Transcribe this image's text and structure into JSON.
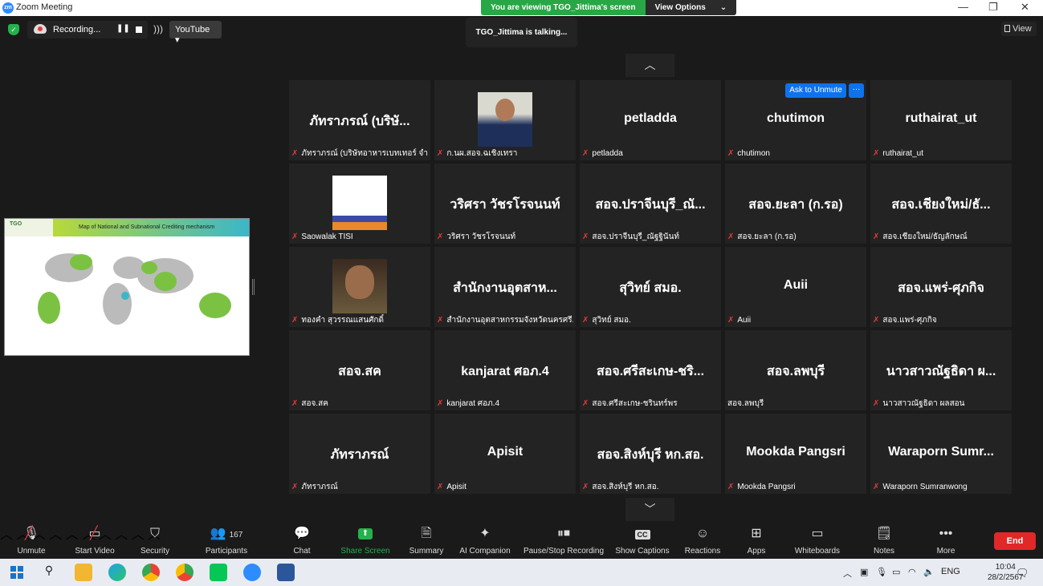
{
  "window": {
    "title": "Zoom Meeting",
    "minimize": "—",
    "restore": "❐",
    "close": "✕"
  },
  "view_banner": {
    "message": "You are viewing TGO_Jittima's screen",
    "options": "View Options"
  },
  "recording": {
    "label": "Recording...",
    "pause": "❚❚"
  },
  "livestream": {
    "label": "YouTube ▾"
  },
  "talking": "TGO_Jittima is talking...",
  "view_button": "View",
  "shared_screen": {
    "title": "Map of National and Subnational Crediting mechanism",
    "logo": "TGO"
  },
  "nav": {
    "up": "︿",
    "down": "﹀"
  },
  "ask_to_unmute": "Ask to Unmute",
  "more_dots": "···",
  "tiles": [
    {
      "name": "ภัทราภรณ์ (บริษั...",
      "label": "ภัทราภรณ์ (บริษัทอาหารเบทเทอร์ จำ...",
      "muted": true
    },
    {
      "name": "",
      "label": "ก.นผ.สอจ.ฉเชิงเทรา",
      "muted": true,
      "thumb": "t1"
    },
    {
      "name": "petladda",
      "label": "petladda",
      "muted": true
    },
    {
      "name": "chutimon",
      "label": "chutimon",
      "muted": true
    },
    {
      "name": "ruthairat_ut",
      "label": "ruthairat_ut",
      "muted": true
    },
    {
      "name": "",
      "label": "Saowalak TISI",
      "muted": true,
      "thumb": "t2"
    },
    {
      "name": "วริศรา วัชรโรจนนท์",
      "label": "วริศรา วัชรโรจนนท์",
      "muted": true
    },
    {
      "name": "สอจ.ปราจีนบุรี_ณั...",
      "label": "สอจ.ปราจีนบุรี_ณัฐฐินันท์",
      "muted": true
    },
    {
      "name": "สอจ.ยะลา (ก.รอ)",
      "label": "สอจ.ยะลา (ก.รอ)",
      "muted": true
    },
    {
      "name": "สอจ.เชียงใหม่/ธั...",
      "label": "สอจ.เชียงใหม่/ธัญลักษณ์",
      "muted": true
    },
    {
      "name": "",
      "label": "ทองคำ สุวรรณแสนศักดิ์",
      "muted": true,
      "thumb": "t3"
    },
    {
      "name": "สำนักงานอุตสาห...",
      "label": "สำนักงานอุตสาหกรรมจังหวัดนครศรี...",
      "muted": true
    },
    {
      "name": "สุวิทย์ สมอ.",
      "label": "สุวิทย์ สมอ.",
      "muted": true
    },
    {
      "name": "Auii",
      "label": "Auii",
      "muted": true
    },
    {
      "name": "สอจ.แพร่-ศุภกิจ",
      "label": "สอจ.แพร่-ศุภกิจ",
      "muted": true
    },
    {
      "name": "สอจ.สค",
      "label": "สอจ.สค",
      "muted": true
    },
    {
      "name": "kanjarat ศอภ.4",
      "label": "kanjarat ศอภ.4",
      "muted": true
    },
    {
      "name": "สอจ.ศรีสะเกษ-ชริ...",
      "label": "สอจ.ศรีสะเกษ-ชรินทร์พร",
      "muted": true
    },
    {
      "name": "สอจ.ลพบุรี",
      "label": "สอจ.ลพบุรี",
      "muted": false
    },
    {
      "name": "นาวสาวณัฐธิดา ผ...",
      "label": "นาวสาวณัฐธิดา ผลสอน",
      "muted": true
    },
    {
      "name": "ภัทราภรณ์",
      "label": "ภัทราภรณ์",
      "muted": true
    },
    {
      "name": "Apisit",
      "label": "Apisit",
      "muted": true
    },
    {
      "name": "สอจ.สิงห์บุรี หก.สอ.",
      "label": "สอจ.สิงห์บุรี หก.สอ.",
      "muted": true
    },
    {
      "name": "Mookda Pangsri",
      "label": "Mookda Pangsri",
      "muted": true
    },
    {
      "name": "Waraporn Sumr...",
      "label": "Waraporn Sumranwong",
      "muted": true
    }
  ],
  "toolbar": {
    "unmute": "Unmute",
    "start_video": "Start Video",
    "security": "Security",
    "participants": "Participants",
    "participants_count": "167",
    "chat": "Chat",
    "share_screen": "Share Screen",
    "summary": "Summary",
    "ai_companion": "AI Companion",
    "pause_recording": "Pause/Stop Recording",
    "captions": "Show Captions",
    "captions_icon": "CC",
    "reactions": "Reactions",
    "apps": "Apps",
    "whiteboards": "Whiteboards",
    "notes": "Notes",
    "more": "More",
    "more_icon": "•••",
    "end": "End"
  },
  "taskbar": {
    "lang": "ENG",
    "time": "10:04",
    "date": "28/2/2567"
  },
  "colors": {
    "accent": "#0e72ed",
    "green": "#25b14c",
    "end": "#e02828"
  }
}
